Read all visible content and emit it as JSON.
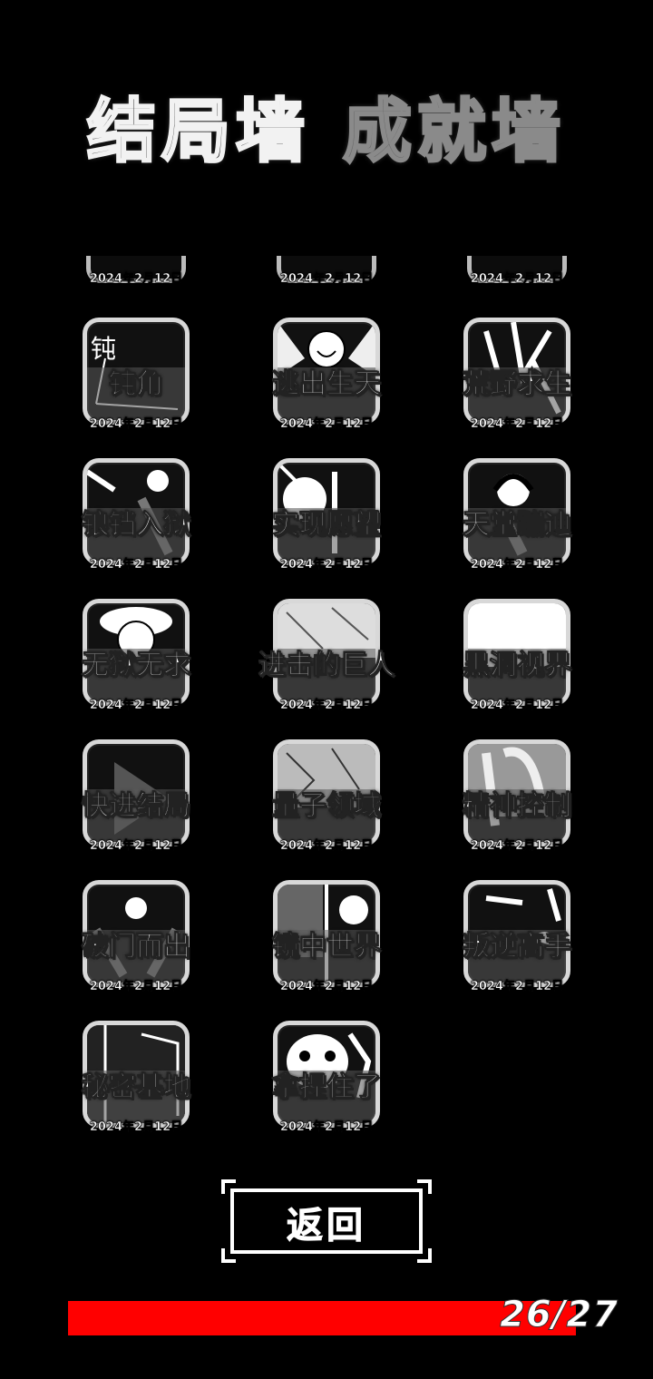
{
  "header": {
    "tab_endings": "结局墙",
    "tab_achievements": "成就墙"
  },
  "partial_row": {
    "dates": [
      "2024年2月12日",
      "2024年2月12日",
      "2024年2月12日"
    ]
  },
  "endings": [
    {
      "title": "钝角",
      "date": "2024年2月12日",
      "art_note": "钝",
      "icon": "obtuse-angle-icon"
    },
    {
      "title": "逃出生天",
      "date": "2024年2月12日",
      "icon": "smiling-face-icon"
    },
    {
      "title": "荒野求生",
      "date": "2024年2月12日",
      "icon": "wilderness-icon"
    },
    {
      "title": "锒铛入狱",
      "date": "2024年2月12日",
      "icon": "prisoner-icon"
    },
    {
      "title": "实现愿望",
      "date": "2024年2月12日",
      "icon": "wish-icon"
    },
    {
      "title": "天堂蹦迪",
      "date": "2024年2月12日",
      "icon": "headphones-icon"
    },
    {
      "title": "无狱无求",
      "date": "2024年2月12日",
      "icon": "chef-face-icon"
    },
    {
      "title": "进击的巨人",
      "date": "2024年2月12日",
      "icon": "giant-icon"
    },
    {
      "title": "黑洞视界",
      "date": "2024年2月12日",
      "icon": "black-hole-icon"
    },
    {
      "title": "快进结局",
      "date": "2024年2月12日",
      "icon": "fast-forward-icon"
    },
    {
      "title": "量子领域",
      "date": "2024年2月12日",
      "icon": "quantum-icon"
    },
    {
      "title": "精神控制",
      "date": "2024年2月12日",
      "icon": "mind-control-icon"
    },
    {
      "title": "破门而出",
      "date": "2024年2月12日",
      "icon": "door-break-icon"
    },
    {
      "title": "镜中世界",
      "date": "2024年2月12日",
      "icon": "mirror-icon"
    },
    {
      "title": "叛逆高手",
      "date": "2024年2月12日",
      "icon": "rebel-icon"
    },
    {
      "title": "秘密基地",
      "date": "2024年2月12日",
      "icon": "secret-base-icon"
    },
    {
      "title": "拿捏住了",
      "date": "2024年2月12日",
      "icon": "grab-face-icon"
    }
  ],
  "back_button": "返回",
  "progress": {
    "count_text": "26/27",
    "unlocked": 26,
    "total": 27,
    "bar_color": "#ff0000"
  }
}
